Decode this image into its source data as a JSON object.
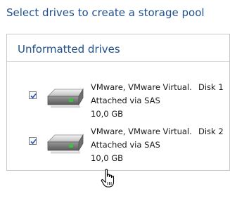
{
  "page": {
    "heading": "Select drives to create a storage pool"
  },
  "panel": {
    "title": "Unformatted drives"
  },
  "drives": [
    {
      "name": "VMware, VMware Virtual...",
      "bus": "Attached via SAS",
      "size": "10,0 GB",
      "disk": "Disk 1",
      "checked": true
    },
    {
      "name": "VMware, VMware Virtual...",
      "bus": "Attached via SAS",
      "size": "10,0 GB",
      "disk": "Disk 2",
      "checked": true
    }
  ],
  "icons": {
    "drive": "hard-drive-icon",
    "cursor": "hand-pointer-icon"
  },
  "colors": {
    "accent": "#1e4f8c",
    "led": "#3fbf3f"
  }
}
